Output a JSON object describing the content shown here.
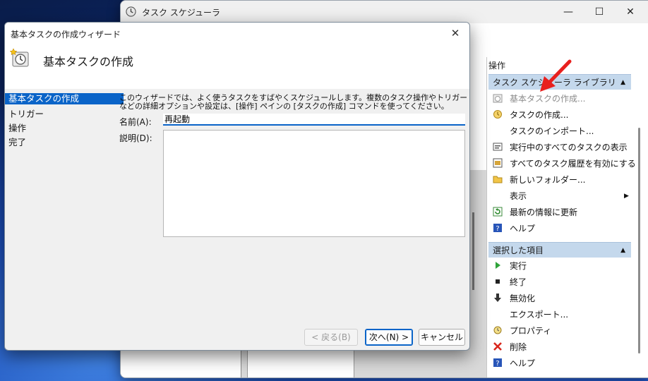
{
  "main_window": {
    "title": "タスク スケジューラ",
    "controls": {
      "minimize": "—",
      "maximize": "☐",
      "close": "✕"
    }
  },
  "actions_pane": {
    "header": "操作",
    "section1": {
      "title": "タスク スケジューラ ライブラリ",
      "items": [
        {
          "label": "基本タスクの作成...",
          "icon": "create-basic-task-icon",
          "disabled": true
        },
        {
          "label": "タスクの作成...",
          "icon": "create-task-icon"
        },
        {
          "label": "タスクのインポート...",
          "icon": ""
        },
        {
          "label": "実行中のすべてのタスクの表示",
          "icon": "running-tasks-icon"
        },
        {
          "label": "すべてのタスク履歴を有効にする",
          "icon": "task-history-icon"
        },
        {
          "label": "新しいフォルダー...",
          "icon": "new-folder-icon"
        },
        {
          "label": "表示",
          "icon": "",
          "submenu": true
        },
        {
          "label": "最新の情報に更新",
          "icon": "refresh-icon"
        },
        {
          "label": "ヘルプ",
          "icon": "help-icon"
        }
      ]
    },
    "section2": {
      "title": "選択した項目",
      "items": [
        {
          "label": "実行",
          "icon": "run-icon"
        },
        {
          "label": "終了",
          "icon": "end-icon"
        },
        {
          "label": "無効化",
          "icon": "disable-icon"
        },
        {
          "label": "エクスポート...",
          "icon": ""
        },
        {
          "label": "プロパティ",
          "icon": "properties-icon"
        },
        {
          "label": "削除",
          "icon": "delete-icon"
        },
        {
          "label": "ヘルプ",
          "icon": "help-icon"
        }
      ]
    }
  },
  "wizard": {
    "title": "基本タスクの作成ウィザード",
    "close": "✕",
    "header_title": "基本タスクの作成",
    "steps": [
      "基本タスクの作成",
      "トリガー",
      "操作",
      "完了"
    ],
    "description": "このウィザードでは、よく使うタスクをすばやくスケジュールします。複数のタスク操作やトリガーなどの詳細オプションや設定は、[操作] ペインの [タスクの作成] コマンドを使ってください。",
    "name_label": "名前(A):",
    "name_value": "再起動",
    "desc_label": "説明(D):",
    "desc_value": "",
    "buttons": {
      "back": "< 戻る(B)",
      "next": "次へ(N) >",
      "cancel": "キャンセル"
    }
  },
  "colors": {
    "accent": "#0a64c8",
    "section_header": "#c4d8ec",
    "pointer": "#e8201e"
  }
}
